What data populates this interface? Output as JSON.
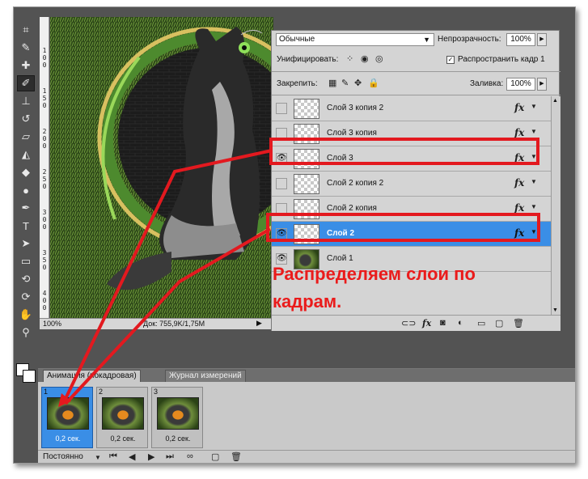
{
  "layers_panel": {
    "blend_mode": "Обычные",
    "opacity_label": "Непрозрачность:",
    "opacity_value": "100%",
    "unify_label": "Унифицировать:",
    "propagate_label": "Распространить кадр 1",
    "propagate_checked": true,
    "lock_label": "Закрепить:",
    "fill_label": "Заливка:",
    "fill_value": "100%",
    "layers": [
      {
        "name": "Слой 3 копия 2",
        "visible": false,
        "fx": true,
        "selected": false
      },
      {
        "name": "Слой 3 копия",
        "visible": false,
        "fx": true,
        "selected": false
      },
      {
        "name": "Слой 3",
        "visible": true,
        "fx": true,
        "selected": false
      },
      {
        "name": "Слой 2 копия 2",
        "visible": false,
        "fx": true,
        "selected": false
      },
      {
        "name": "Слой 2 копия",
        "visible": false,
        "fx": true,
        "selected": false
      },
      {
        "name": "Слой 2",
        "visible": true,
        "fx": true,
        "selected": true
      },
      {
        "name": "Слой 1",
        "visible": true,
        "fx": false,
        "selected": false
      }
    ],
    "fx_glyph": "fx"
  },
  "document": {
    "zoom": "100%",
    "doc_info": "Док: 755,9K/1,75M",
    "ruler_ticks": [
      "1",
      "0",
      "0",
      "1",
      "5",
      "0",
      "2",
      "0",
      "0",
      "2",
      "5",
      "0",
      "3",
      "0",
      "0",
      "3",
      "5",
      "0",
      "4",
      "0",
      "0"
    ]
  },
  "annotation": {
    "line1": "Распределяем слои по",
    "line2": "кадрам.",
    "color": "#ea1b1b"
  },
  "animation_panel": {
    "tab_active": "Анимация (покадровая)",
    "tab_other": "Журнал измерений",
    "frames": [
      {
        "number": "1",
        "delay": "0,2 сек.",
        "selected": true
      },
      {
        "number": "2",
        "delay": "0,2 сек.",
        "selected": false
      },
      {
        "number": "3",
        "delay": "0,2 сек.",
        "selected": false
      }
    ],
    "loop": "Постоянно"
  },
  "colors": {
    "panel": "#d4d4d4",
    "selection": "#3a8ee6",
    "highlight_box": "#e3191f",
    "app_bg": "#535353"
  }
}
